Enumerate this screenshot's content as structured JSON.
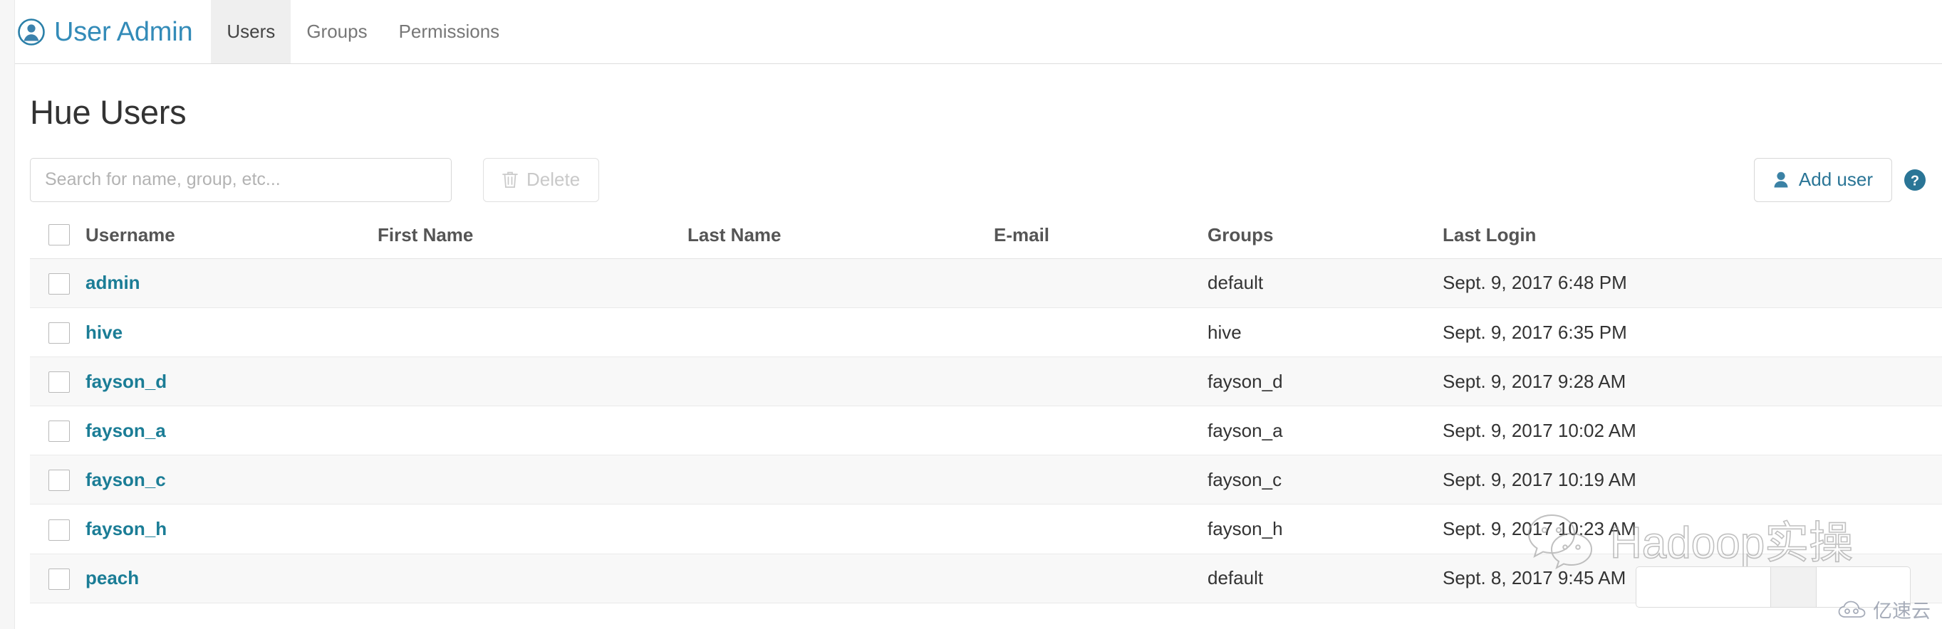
{
  "navbar": {
    "brand": {
      "label": "User Admin",
      "icon": "user-circle-icon",
      "color": "#338bb8"
    },
    "tabs": [
      {
        "label": "Users",
        "active": true
      },
      {
        "label": "Groups",
        "active": false
      },
      {
        "label": "Permissions",
        "active": false
      }
    ]
  },
  "page": {
    "title": "Hue Users"
  },
  "toolbar": {
    "search": {
      "placeholder": "Search for name, group, etc...",
      "value": ""
    },
    "delete": {
      "label": "Delete",
      "icon": "trash-icon",
      "disabled": true
    },
    "add_user": {
      "label": "Add user",
      "icon": "user-plus-icon"
    },
    "help": {
      "icon": "help-circle-icon",
      "label": "?"
    }
  },
  "table": {
    "select_all_label": "",
    "columns": [
      "Username",
      "First Name",
      "Last Name",
      "E-mail",
      "Groups",
      "Last Login"
    ],
    "rows": [
      {
        "username": "admin",
        "first_name": "",
        "last_name": "",
        "email": "",
        "groups": "default",
        "last_login": "Sept. 9, 2017 6:48 PM"
      },
      {
        "username": "hive",
        "first_name": "",
        "last_name": "",
        "email": "",
        "groups": "hive",
        "last_login": "Sept. 9, 2017 6:35 PM"
      },
      {
        "username": "fayson_d",
        "first_name": "",
        "last_name": "",
        "email": "",
        "groups": "fayson_d",
        "last_login": "Sept. 9, 2017 9:28 AM"
      },
      {
        "username": "fayson_a",
        "first_name": "",
        "last_name": "",
        "email": "",
        "groups": "fayson_a",
        "last_login": "Sept. 9, 2017 10:02 AM"
      },
      {
        "username": "fayson_c",
        "first_name": "",
        "last_name": "",
        "email": "",
        "groups": "fayson_c",
        "last_login": "Sept. 9, 2017 10:19 AM"
      },
      {
        "username": "fayson_h",
        "first_name": "",
        "last_name": "",
        "email": "",
        "groups": "fayson_h",
        "last_login": "Sept. 9, 2017 10:23 AM"
      },
      {
        "username": "peach",
        "first_name": "",
        "last_name": "",
        "email": "",
        "groups": "default",
        "last_login": "Sept. 8, 2017 9:45 AM"
      }
    ]
  },
  "pagination": {
    "page_value": "",
    "mid_value": "",
    "right_value": ""
  },
  "watermarks": {
    "hadoop": {
      "text": "Hadoop实操",
      "icon": "wechat-bubble-icon"
    },
    "yisu": {
      "text": "亿速云",
      "icon": "cloud-icon"
    }
  }
}
